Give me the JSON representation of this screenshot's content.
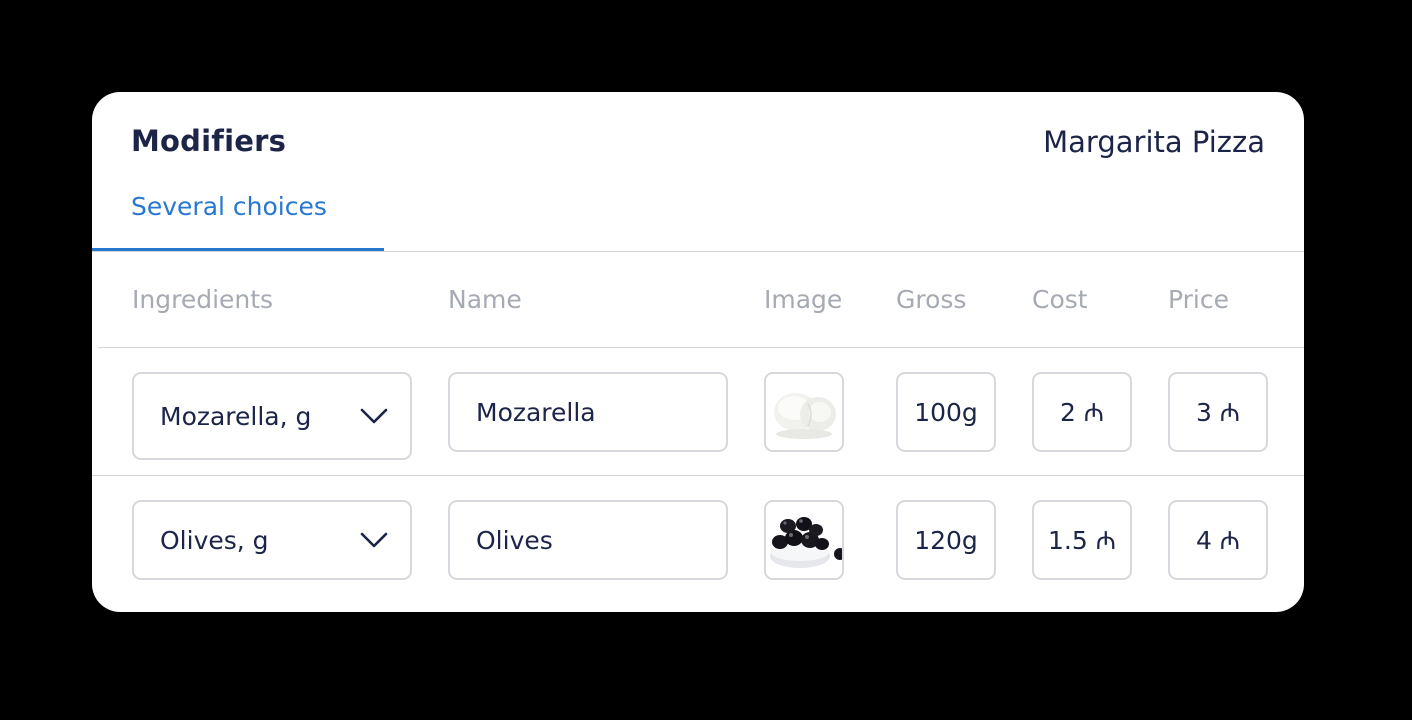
{
  "header": {
    "title": "Modifiers",
    "product": "Margarita Pizza"
  },
  "tabs": [
    {
      "label": "Several choices",
      "active": true
    }
  ],
  "table": {
    "columns": [
      "Ingredients",
      "Name",
      "Image",
      "Gross",
      "Cost",
      "Price"
    ],
    "rows": [
      {
        "ingredient": "Mozarella, g",
        "name": "Mozarella",
        "image": "mozzarella-image",
        "gross": "100g",
        "cost": "2 ₼",
        "price": "3 ₼"
      },
      {
        "ingredient": "Olives, g",
        "name": "Olives",
        "image": "olives-image",
        "gross": "120g",
        "cost": "1.5 ₼",
        "price": "4 ₼"
      }
    ]
  },
  "icons": {
    "dropdown": "chevron-down-icon"
  },
  "colors": {
    "background": "#000000",
    "card": "#ffffff",
    "text": "#1c2447",
    "accent": "#2878d0",
    "muted": "#a6aab4",
    "border": "#d6d8dd"
  }
}
